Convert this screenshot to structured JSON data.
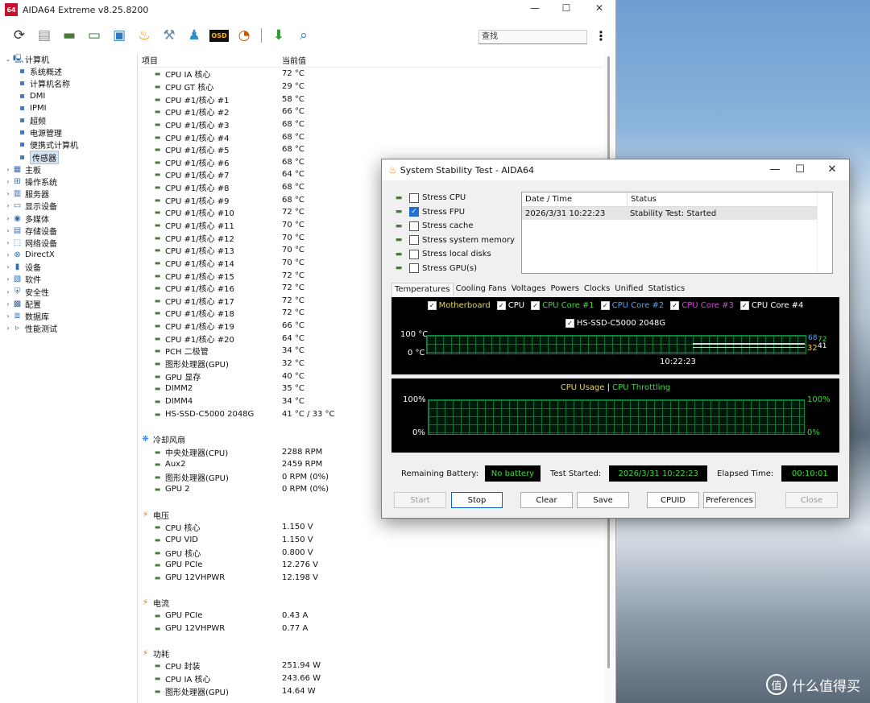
{
  "main_window": {
    "title": "AIDA64 Extreme v8.25.8200",
    "icon_text": "64",
    "search_placeholder": "查找",
    "toolbar_icons": [
      "refresh-icon",
      "report-icon",
      "motherboard-icon",
      "memory-icon",
      "network-icon",
      "flame-icon",
      "tools-icon",
      "users-icon",
      "osd-icon",
      "gauge-icon",
      "download-icon",
      "search-icon"
    ],
    "osd_label": "OSD"
  },
  "tree": [
    {
      "label": "计算机",
      "expanded": true,
      "level": 0
    },
    {
      "label": "系统概述",
      "level": 1
    },
    {
      "label": "计算机名称",
      "level": 1
    },
    {
      "label": "DMI",
      "level": 1
    },
    {
      "label": "IPMI",
      "level": 1
    },
    {
      "label": "超频",
      "level": 1
    },
    {
      "label": "电源管理",
      "level": 1
    },
    {
      "label": "便携式计算机",
      "level": 1
    },
    {
      "label": "传感器",
      "level": 1,
      "selected": true
    },
    {
      "label": "主板",
      "level": 0
    },
    {
      "label": "操作系统",
      "level": 0
    },
    {
      "label": "服务器",
      "level": 0
    },
    {
      "label": "显示设备",
      "level": 0
    },
    {
      "label": "多媒体",
      "level": 0
    },
    {
      "label": "存储设备",
      "level": 0
    },
    {
      "label": "网络设备",
      "level": 0
    },
    {
      "label": "DirectX",
      "level": 0
    },
    {
      "label": "设备",
      "level": 0
    },
    {
      "label": "软件",
      "level": 0
    },
    {
      "label": "安全性",
      "level": 0
    },
    {
      "label": "配置",
      "level": 0
    },
    {
      "label": "数据库",
      "level": 0
    },
    {
      "label": "性能测试",
      "level": 0
    }
  ],
  "table": {
    "col_item": "项目",
    "col_value": "当前值",
    "sections": [
      {
        "title": "",
        "rows": [
          [
            "CPU IA 核心",
            "72 °C"
          ],
          [
            "CPU GT 核心",
            "29 °C"
          ],
          [
            "CPU #1/核心 #1",
            "58 °C"
          ],
          [
            "CPU #1/核心 #2",
            "66 °C"
          ],
          [
            "CPU #1/核心 #3",
            "68 °C"
          ],
          [
            "CPU #1/核心 #4",
            "68 °C"
          ],
          [
            "CPU #1/核心 #5",
            "68 °C"
          ],
          [
            "CPU #1/核心 #6",
            "68 °C"
          ],
          [
            "CPU #1/核心 #7",
            "64 °C"
          ],
          [
            "CPU #1/核心 #8",
            "68 °C"
          ],
          [
            "CPU #1/核心 #9",
            "68 °C"
          ],
          [
            "CPU #1/核心 #10",
            "72 °C"
          ],
          [
            "CPU #1/核心 #11",
            "70 °C"
          ],
          [
            "CPU #1/核心 #12",
            "70 °C"
          ],
          [
            "CPU #1/核心 #13",
            "70 °C"
          ],
          [
            "CPU #1/核心 #14",
            "70 °C"
          ],
          [
            "CPU #1/核心 #15",
            "72 °C"
          ],
          [
            "CPU #1/核心 #16",
            "72 °C"
          ],
          [
            "CPU #1/核心 #17",
            "72 °C"
          ],
          [
            "CPU #1/核心 #18",
            "72 °C"
          ],
          [
            "CPU #1/核心 #19",
            "66 °C"
          ],
          [
            "CPU #1/核心 #20",
            "64 °C"
          ],
          [
            "PCH 二极管",
            "34 °C"
          ],
          [
            "图形处理器(GPU)",
            "32 °C"
          ],
          [
            "GPU 显存",
            "40 °C"
          ],
          [
            "DIMM2",
            "35 °C"
          ],
          [
            "DIMM4",
            "34 °C"
          ],
          [
            "HS-SSD-C5000 2048G",
            "41 °C / 33 °C"
          ]
        ]
      },
      {
        "title": "冷却风扇",
        "rows": [
          [
            "中央处理器(CPU)",
            "2288 RPM"
          ],
          [
            "Aux2",
            "2459 RPM"
          ],
          [
            "图形处理器(GPU)",
            "0 RPM  (0%)"
          ],
          [
            "GPU 2",
            "0 RPM  (0%)"
          ]
        ]
      },
      {
        "title": "电压",
        "rows": [
          [
            "CPU 核心",
            "1.150 V"
          ],
          [
            "CPU VID",
            "1.150 V"
          ],
          [
            "GPU 核心",
            "0.800 V"
          ],
          [
            "GPU PCIe",
            "12.276 V"
          ],
          [
            "GPU 12VHPWR",
            "12.198 V"
          ]
        ]
      },
      {
        "title": "电流",
        "rows": [
          [
            "GPU PCIe",
            "0.43 A"
          ],
          [
            "GPU 12VHPWR",
            "0.77 A"
          ]
        ]
      },
      {
        "title": "功耗",
        "rows": [
          [
            "CPU 封装",
            "251.94 W"
          ],
          [
            "CPU IA 核心",
            "243.66 W"
          ],
          [
            "图形处理器(GPU)",
            "14.64 W"
          ]
        ]
      }
    ]
  },
  "dialog": {
    "title": "System Stability Test - AIDA64",
    "stress": [
      {
        "label": "Stress CPU",
        "checked": false,
        "icon": "cpu-chip-icon"
      },
      {
        "label": "Stress FPU",
        "checked": true,
        "icon": "fpu-icon"
      },
      {
        "label": "Stress cache",
        "checked": false,
        "icon": "cache-icon"
      },
      {
        "label": "Stress system memory",
        "checked": false,
        "icon": "memory-module-icon"
      },
      {
        "label": "Stress local disks",
        "checked": false,
        "icon": "disk-icon"
      },
      {
        "label": "Stress GPU(s)",
        "checked": false,
        "icon": "gpu-icon"
      }
    ],
    "log": {
      "col_date": "Date / Time",
      "col_status": "Status",
      "rows": [
        [
          "2026/3/31 10:22:23",
          "Stability Test: Started"
        ]
      ]
    },
    "tabs": [
      "Temperatures",
      "Cooling Fans",
      "Voltages",
      "Powers",
      "Clocks",
      "Unified",
      "Statistics"
    ],
    "active_tab": "Temperatures",
    "temp_legend": [
      {
        "label": "Motherboard",
        "color": "#e8d44d"
      },
      {
        "label": "CPU",
        "color": "#ffffff"
      },
      {
        "label": "CPU Core #1",
        "color": "#33dd33"
      },
      {
        "label": "CPU Core #2",
        "color": "#4da6ff"
      },
      {
        "label": "CPU Core #3",
        "color": "#e040e0"
      },
      {
        "label": "CPU Core #4",
        "color": "#ffffff"
      }
    ],
    "temp_legend2": {
      "label": "HS-SSD-C5000 2048G",
      "color": "#ffffff"
    },
    "temp_axis": {
      "top": "100 °C",
      "bottom": "0 °C",
      "time": "10:22:23"
    },
    "temp_right_values": {
      "high": "68",
      "high2": "72",
      "low": "32",
      "low2": "41"
    },
    "usage_title": {
      "usage": "CPU Usage",
      "sep": "|",
      "throttle": "CPU Throttling"
    },
    "usage_axis": {
      "left_top": "100%",
      "left_bottom": "0%",
      "right_top": "100%",
      "right_bottom": "0%"
    },
    "remaining_battery_label": "Remaining Battery:",
    "remaining_battery_value": "No battery",
    "test_started_label": "Test Started:",
    "test_started_value": "2026/3/31 10:22:23",
    "elapsed_label": "Elapsed Time:",
    "elapsed_value": "00:10:01",
    "buttons": {
      "start": "Start",
      "stop": "Stop",
      "clear": "Clear",
      "save": "Save",
      "cpuid": "CPUID",
      "preferences": "Preferences",
      "close": "Close"
    }
  },
  "watermark": {
    "logo": "值",
    "text": "什么值得买"
  }
}
